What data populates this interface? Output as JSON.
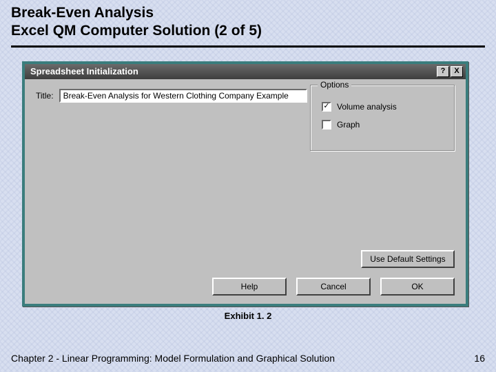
{
  "header": {
    "line1": "Break-Even Analysis",
    "line2": "Excel QM Computer Solution (2 of 5)"
  },
  "dialog": {
    "titlebar": "Spreadsheet Initialization",
    "help_btn": "?",
    "close_btn": "X",
    "title_label": "Title:",
    "title_value": "Break-Even Analysis for Western Clothing Company Example",
    "options": {
      "legend": "Options",
      "volume_label": "Volume analysis",
      "volume_checked": "✓",
      "graph_label": "Graph",
      "graph_checked": ""
    },
    "buttons": {
      "defaults": "Use Default Settings",
      "help": "Help",
      "cancel": "Cancel",
      "ok": "OK"
    }
  },
  "exhibit": "Exhibit 1. 2",
  "footer": {
    "chapter": "Chapter 2 - Linear Programming:  Model Formulation and Graphical Solution",
    "page": "16"
  }
}
